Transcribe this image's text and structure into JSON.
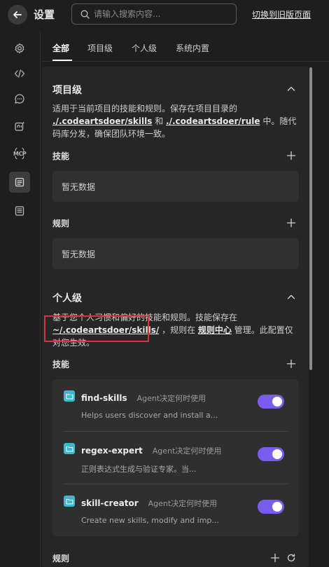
{
  "header": {
    "title": "设置",
    "search_placeholder": "请输入搜索内容...",
    "legacy_link": "切换到旧版页面"
  },
  "rail": {
    "items": [
      {
        "icon": "gear-icon"
      },
      {
        "icon": "code-icon"
      },
      {
        "icon": "chat-icon"
      },
      {
        "icon": "ai-sparkle-icon"
      },
      {
        "icon": "mcp-icon",
        "label": "MCP"
      },
      {
        "icon": "rules-icon",
        "active": true
      },
      {
        "icon": "memory-icon"
      }
    ]
  },
  "tabs": [
    {
      "label": "全部",
      "active": true
    },
    {
      "label": "项目级"
    },
    {
      "label": "个人级"
    },
    {
      "label": "系统内置"
    }
  ],
  "project": {
    "title": "项目级",
    "desc_1": "适用于当前项目的技能和规则。保存在项目目录的",
    "path_skills": "./.codeartsdoer/skills",
    "and": "和",
    "path_rule": "./.codeartsdoer/rule",
    "desc_2": "中。随代码库分发，确保团队环境一致。",
    "skills_label": "技能",
    "skills_empty": "暂无数据",
    "rules_label": "规则",
    "rules_empty": "暂无数据"
  },
  "personal": {
    "title": "个人级",
    "desc_1": "基于您个人习惯和偏好的技能和规则。技能保存在",
    "path_skills": "~/.codeartsdoer/skills/",
    "desc_2": "，规则在",
    "rule_center": "规则中心",
    "desc_3": "管理。此配置仅对您生效。",
    "skills_label": "技能",
    "rules_label": "规则",
    "skills": [
      {
        "name": "find-skills",
        "mode": "Agent决定何时使用",
        "desc": "Helps users discover and install a...",
        "enabled": true
      },
      {
        "name": "regex-expert",
        "mode": "Agent决定何时使用",
        "desc": "正则表达式生成与验证专家。当...",
        "enabled": true
      },
      {
        "name": "skill-creator",
        "mode": "Agent决定何时使用",
        "desc": "Create new skills, modify and imp...",
        "enabled": true
      }
    ]
  },
  "colors": {
    "toggle_on": "#7a5cf0",
    "skill_icon": "#3bb8c9",
    "highlight": "#d9343a"
  }
}
